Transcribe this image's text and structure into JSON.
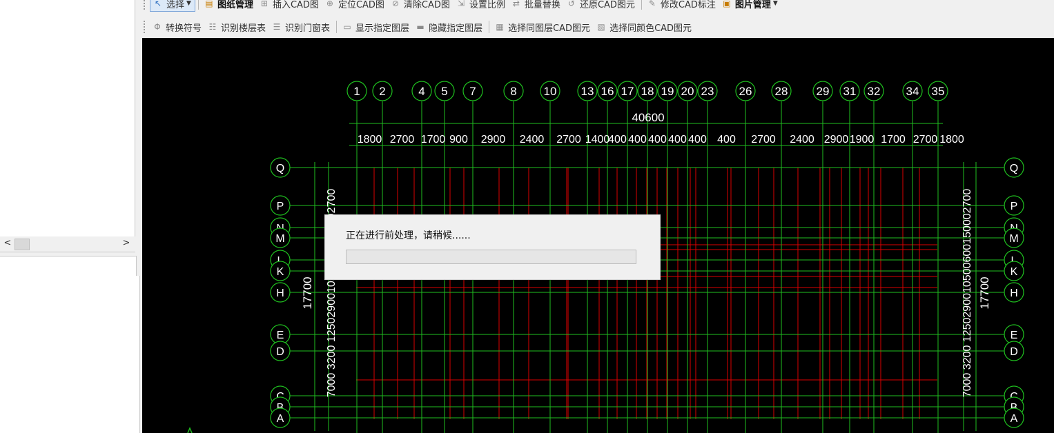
{
  "toolbar_row1": [
    {
      "label": "选择",
      "icon": "cursor-icon",
      "dropdown": true,
      "selected": true
    },
    {
      "label": "图纸管理",
      "icon": "drawing-manager-icon",
      "bold": true
    },
    {
      "label": "插入CAD图",
      "icon": "insert-cad-icon"
    },
    {
      "label": "定位CAD图",
      "icon": "locate-cad-icon"
    },
    {
      "label": "清除CAD图",
      "icon": "clear-cad-icon"
    },
    {
      "label": "设置比例",
      "icon": "scale-icon"
    },
    {
      "label": "批量替换",
      "icon": "batch-replace-icon"
    },
    {
      "label": "还原CAD图元",
      "icon": "restore-cad-icon"
    },
    {
      "label": "修改CAD标注",
      "icon": "edit-cad-dimension-icon"
    },
    {
      "label": "图片管理",
      "icon": "image-manager-icon",
      "dropdown": true,
      "bold": true
    }
  ],
  "toolbar_row2": [
    {
      "label": "转换符号",
      "icon": "convert-symbol-icon"
    },
    {
      "label": "识别楼层表",
      "icon": "identify-floor-table-icon"
    },
    {
      "label": "识别门窗表",
      "icon": "identify-door-window-table-icon"
    },
    {
      "label": "显示指定图层",
      "icon": "show-layer-icon"
    },
    {
      "label": "隐藏指定图层",
      "icon": "hide-layer-icon"
    },
    {
      "label": "选择同图层CAD图元",
      "icon": "select-same-layer-icon"
    },
    {
      "label": "选择同颜色CAD图元",
      "icon": "select-same-color-icon"
    }
  ],
  "scroll": {
    "left": "<",
    "right": ">"
  },
  "cad": {
    "top_axes": [
      "1",
      "2",
      "4",
      "5",
      "7",
      "8",
      "10",
      "13",
      "16",
      "17",
      "18",
      "19",
      "20",
      "23",
      "26",
      "28",
      "29",
      "31",
      "32",
      "34",
      "35"
    ],
    "total_width": "40600",
    "dims_top": [
      "1800",
      "2700",
      "1700",
      "900",
      "2900",
      "2400",
      "2700",
      "1400",
      "400",
      "400",
      "400",
      "400",
      "400",
      "400",
      "2700",
      "2400",
      "2900",
      "1900",
      "1700",
      "2700",
      "1800"
    ],
    "left_axes": [
      "Q",
      "P",
      "N",
      "M",
      "L",
      "K",
      "H",
      "E",
      "D",
      "C",
      "B",
      "A"
    ],
    "total_height": "17700",
    "dims_side_text": "7000 3200 1250290010500600150002700"
  },
  "dialog": {
    "message": "正在进行前处理，请稍候......",
    "progress": 0.0
  },
  "colors": {
    "canvas": "#000000",
    "axis": "#1fbf1f",
    "grid": "#dd0000",
    "text": "#ffffff",
    "progress_fill": "#06b025"
  }
}
